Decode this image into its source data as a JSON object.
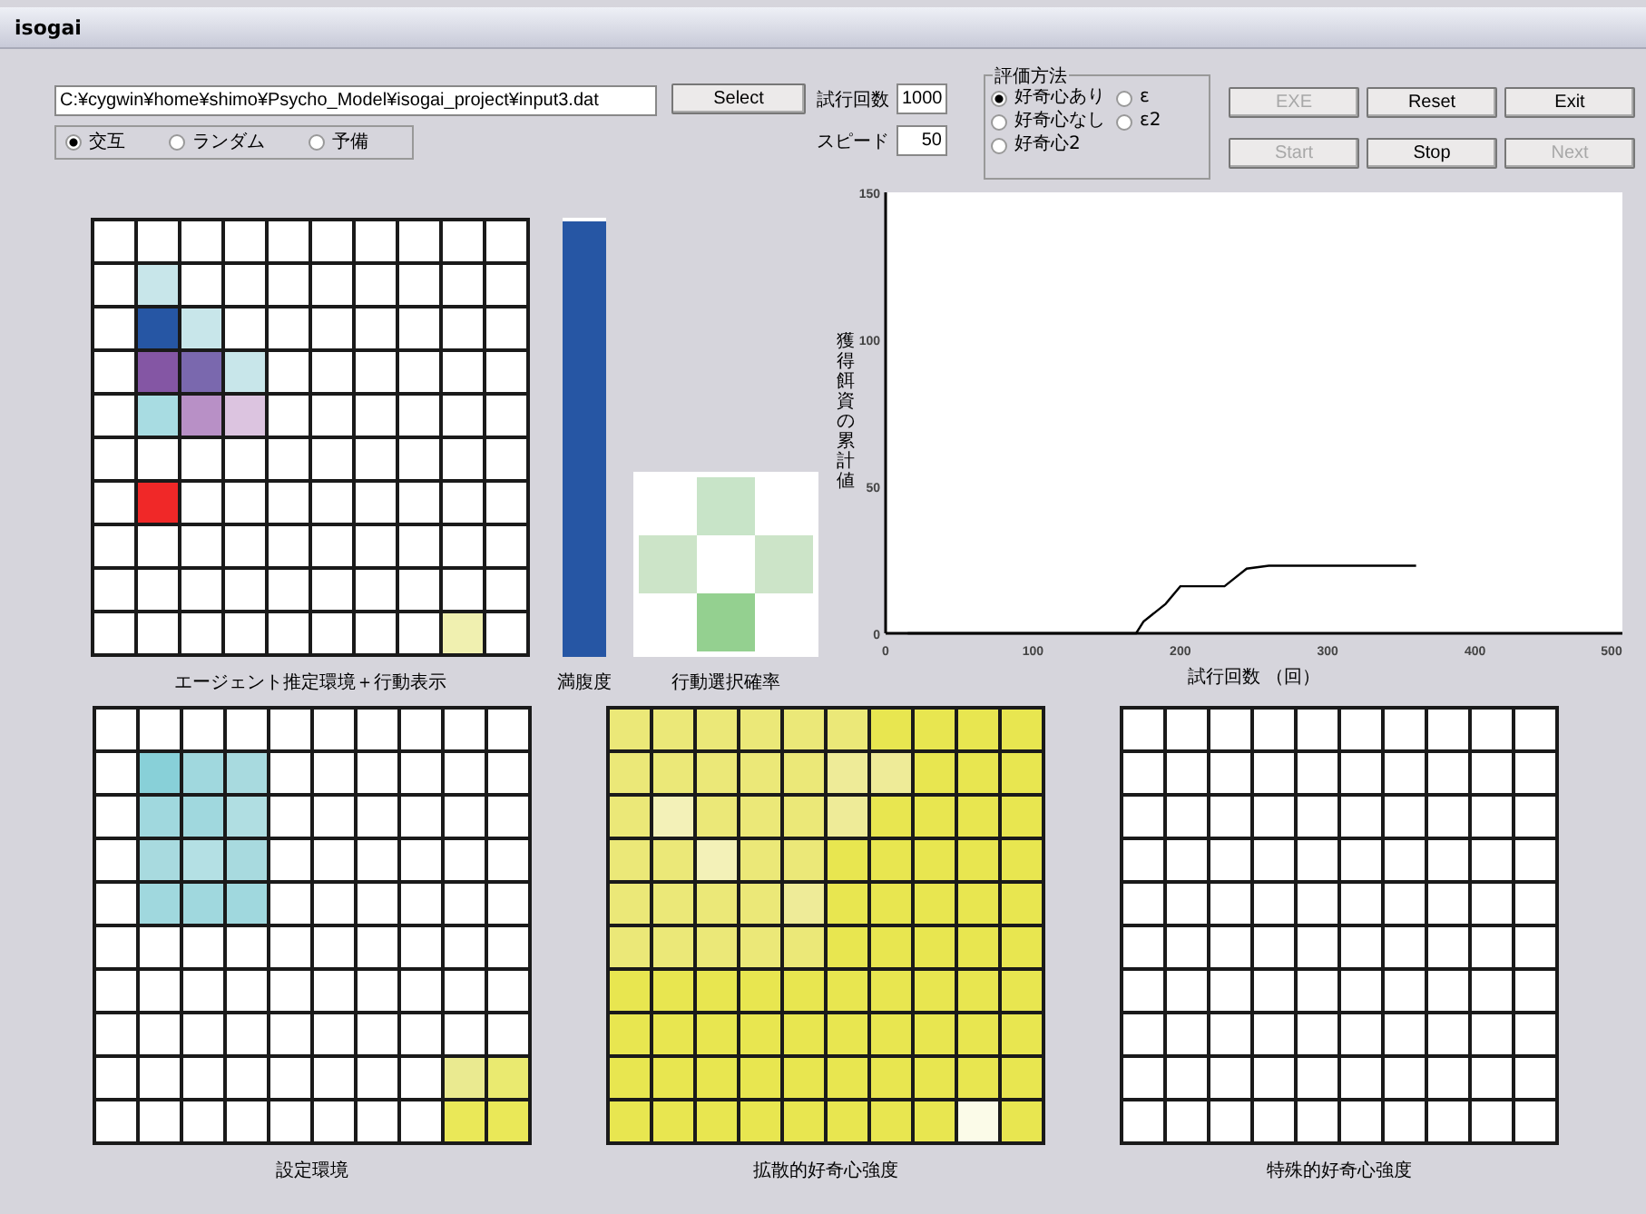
{
  "window": {
    "title": "isogai"
  },
  "file": {
    "path": "C:¥cygwin¥home¥shimo¥Psycho_Model¥isogai_project¥input3.dat",
    "button": "Select"
  },
  "order_options": [
    {
      "label": "交互",
      "selected": true
    },
    {
      "label": "ランダム",
      "selected": false
    },
    {
      "label": "予備",
      "selected": false
    }
  ],
  "settings": [
    {
      "label": "試行回数",
      "value": "1000"
    },
    {
      "label": "スピード",
      "value": "50"
    }
  ],
  "evaluation": {
    "title": "評価方法",
    "options": [
      {
        "label": "好奇心あり",
        "selected": true
      },
      {
        "label": "好奇心なし",
        "selected": false
      },
      {
        "label": "好奇心2",
        "selected": false
      },
      {
        "label": "ε",
        "selected": false
      },
      {
        "label": "ε2",
        "selected": false
      }
    ]
  },
  "buttons": [
    {
      "label": "EXE",
      "disabled": true
    },
    {
      "label": "Reset",
      "disabled": false
    },
    {
      "label": "Exit",
      "disabled": false
    },
    {
      "label": "Start",
      "disabled": true
    },
    {
      "label": "Stop",
      "disabled": false
    },
    {
      "label": "Next",
      "disabled": true
    }
  ],
  "agent_grid": {
    "caption": "エージェント推定環境＋行動表示",
    "rows": [
      [
        {
          "color": "#ffffff"
        },
        {
          "color": "#ffffff"
        },
        {
          "color": "#ffffff"
        },
        {
          "color": "#ffffff"
        },
        {
          "color": "#ffffff"
        },
        {
          "color": "#ffffff"
        },
        {
          "color": "#ffffff"
        },
        {
          "color": "#ffffff"
        },
        {
          "color": "#ffffff"
        },
        {
          "color": "#ffffff"
        }
      ],
      [
        {
          "color": "#ffffff"
        },
        {
          "color": "#c8e6ea"
        },
        {
          "color": "#ffffff"
        },
        {
          "color": "#ffffff"
        },
        {
          "color": "#ffffff"
        },
        {
          "color": "#ffffff"
        },
        {
          "color": "#ffffff"
        },
        {
          "color": "#ffffff"
        },
        {
          "color": "#ffffff"
        },
        {
          "color": "#ffffff"
        }
      ],
      [
        {
          "color": "#ffffff"
        },
        {
          "color": "#2656a4"
        },
        {
          "color": "#c8e6ea"
        },
        {
          "color": "#ffffff"
        },
        {
          "color": "#ffffff"
        },
        {
          "color": "#ffffff"
        },
        {
          "color": "#ffffff"
        },
        {
          "color": "#ffffff"
        },
        {
          "color": "#ffffff"
        },
        {
          "color": "#ffffff"
        }
      ],
      [
        {
          "color": "#ffffff"
        },
        {
          "color": "#8456a4"
        },
        {
          "color": "#7a68ae"
        },
        {
          "color": "#c8e6ea"
        },
        {
          "color": "#ffffff"
        },
        {
          "color": "#ffffff"
        },
        {
          "color": "#ffffff"
        },
        {
          "color": "#ffffff"
        },
        {
          "color": "#ffffff"
        },
        {
          "color": "#ffffff"
        }
      ],
      [
        {
          "color": "#ffffff"
        },
        {
          "color": "#a8dce2"
        },
        {
          "color": "#b890c6"
        },
        {
          "color": "#dcc4e0"
        },
        {
          "color": "#ffffff"
        },
        {
          "color": "#ffffff"
        },
        {
          "color": "#ffffff"
        },
        {
          "color": "#ffffff"
        },
        {
          "color": "#ffffff"
        },
        {
          "color": "#ffffff"
        }
      ],
      [
        {
          "color": "#ffffff"
        },
        {
          "color": "#ffffff"
        },
        {
          "color": "#ffffff"
        },
        {
          "color": "#ffffff"
        },
        {
          "color": "#ffffff"
        },
        {
          "color": "#ffffff"
        },
        {
          "color": "#ffffff"
        },
        {
          "color": "#ffffff"
        },
        {
          "color": "#ffffff"
        },
        {
          "color": "#ffffff"
        }
      ],
      [
        {
          "color": "#ffffff"
        },
        {
          "color": "#f02828"
        },
        {
          "color": "#ffffff"
        },
        {
          "color": "#ffffff"
        },
        {
          "color": "#ffffff"
        },
        {
          "color": "#ffffff"
        },
        {
          "color": "#ffffff"
        },
        {
          "color": "#ffffff"
        },
        {
          "color": "#ffffff"
        },
        {
          "color": "#ffffff"
        }
      ],
      [
        {
          "color": "#ffffff"
        },
        {
          "color": "#ffffff"
        },
        {
          "color": "#ffffff"
        },
        {
          "color": "#ffffff"
        },
        {
          "color": "#ffffff"
        },
        {
          "color": "#ffffff"
        },
        {
          "color": "#ffffff"
        },
        {
          "color": "#ffffff"
        },
        {
          "color": "#ffffff"
        },
        {
          "color": "#ffffff"
        }
      ],
      [
        {
          "color": "#ffffff"
        },
        {
          "color": "#ffffff"
        },
        {
          "color": "#ffffff"
        },
        {
          "color": "#ffffff"
        },
        {
          "color": "#ffffff"
        },
        {
          "color": "#ffffff"
        },
        {
          "color": "#ffffff"
        },
        {
          "color": "#ffffff"
        },
        {
          "color": "#ffffff"
        },
        {
          "color": "#ffffff"
        }
      ],
      [
        {
          "color": "#ffffff"
        },
        {
          "color": "#ffffff"
        },
        {
          "color": "#ffffff"
        },
        {
          "color": "#ffffff"
        },
        {
          "color": "#ffffff"
        },
        {
          "color": "#ffffff"
        },
        {
          "color": "#ffffff"
        },
        {
          "color": "#ffffff"
        },
        {
          "color": "#f0f0b0"
        },
        {
          "color": "#ffffff"
        }
      ]
    ]
  },
  "satiety": {
    "caption": "満腹度",
    "level": 0.99
  },
  "action_probability": {
    "caption": "行動選択確率",
    "cells": [
      {
        "kind": "up",
        "color": "#c8e4c8"
      },
      {
        "kind": "left",
        "color": "#cce4c8"
      },
      {
        "kind": "right",
        "color": "#cce4c8"
      },
      {
        "kind": "down",
        "color": "#94d090"
      }
    ]
  },
  "chart": {
    "chart_data": {
      "type": "line",
      "xlabel": "試行回数 （回）",
      "ylabel": "獲得餌資の累計値",
      "x": [
        15,
        170,
        175,
        185,
        190,
        200,
        230,
        235,
        245,
        260,
        360
      ],
      "series": [
        {
          "color": "#000000",
          "values": [
            0,
            0,
            4,
            8,
            10,
            16,
            16,
            18,
            22,
            23,
            23
          ]
        }
      ],
      "xlim": [
        0,
        500
      ],
      "ylim": [
        0,
        150
      ],
      "xticks": [
        0,
        100,
        200,
        300,
        400,
        500
      ],
      "yticks": [
        0,
        50,
        100,
        150
      ]
    }
  },
  "setting_grid": {
    "caption": "設定環境",
    "rows": [
      [
        {
          "color": "#ffffff"
        },
        {
          "color": "#ffffff"
        },
        {
          "color": "#ffffff"
        },
        {
          "color": "#ffffff"
        },
        {
          "color": "#ffffff"
        },
        {
          "color": "#ffffff"
        },
        {
          "color": "#ffffff"
        },
        {
          "color": "#ffffff"
        },
        {
          "color": "#ffffff"
        },
        {
          "color": "#ffffff"
        }
      ],
      [
        {
          "color": "#ffffff"
        },
        {
          "color": "#88d0d8"
        },
        {
          "color": "#a0d8de"
        },
        {
          "color": "#a8dadf"
        },
        {
          "color": "#ffffff"
        },
        {
          "color": "#ffffff"
        },
        {
          "color": "#ffffff"
        },
        {
          "color": "#ffffff"
        },
        {
          "color": "#ffffff"
        },
        {
          "color": "#ffffff"
        }
      ],
      [
        {
          "color": "#ffffff"
        },
        {
          "color": "#a0d8de"
        },
        {
          "color": "#a0d8de"
        },
        {
          "color": "#b0dee2"
        },
        {
          "color": "#ffffff"
        },
        {
          "color": "#ffffff"
        },
        {
          "color": "#ffffff"
        },
        {
          "color": "#ffffff"
        },
        {
          "color": "#ffffff"
        },
        {
          "color": "#ffffff"
        }
      ],
      [
        {
          "color": "#ffffff"
        },
        {
          "color": "#a8dadf"
        },
        {
          "color": "#b4e0e4"
        },
        {
          "color": "#a8dadf"
        },
        {
          "color": "#ffffff"
        },
        {
          "color": "#ffffff"
        },
        {
          "color": "#ffffff"
        },
        {
          "color": "#ffffff"
        },
        {
          "color": "#ffffff"
        },
        {
          "color": "#ffffff"
        }
      ],
      [
        {
          "color": "#ffffff"
        },
        {
          "color": "#a0d8de"
        },
        {
          "color": "#a0d8de"
        },
        {
          "color": "#a0d8de"
        },
        {
          "color": "#ffffff"
        },
        {
          "color": "#ffffff"
        },
        {
          "color": "#ffffff"
        },
        {
          "color": "#ffffff"
        },
        {
          "color": "#ffffff"
        },
        {
          "color": "#ffffff"
        }
      ],
      [
        {
          "color": "#ffffff"
        },
        {
          "color": "#ffffff"
        },
        {
          "color": "#ffffff"
        },
        {
          "color": "#ffffff"
        },
        {
          "color": "#ffffff"
        },
        {
          "color": "#ffffff"
        },
        {
          "color": "#ffffff"
        },
        {
          "color": "#ffffff"
        },
        {
          "color": "#ffffff"
        },
        {
          "color": "#ffffff"
        }
      ],
      [
        {
          "color": "#ffffff"
        },
        {
          "color": "#ffffff"
        },
        {
          "color": "#ffffff"
        },
        {
          "color": "#ffffff"
        },
        {
          "color": "#ffffff"
        },
        {
          "color": "#ffffff"
        },
        {
          "color": "#ffffff"
        },
        {
          "color": "#ffffff"
        },
        {
          "color": "#ffffff"
        },
        {
          "color": "#ffffff"
        }
      ],
      [
        {
          "color": "#ffffff"
        },
        {
          "color": "#ffffff"
        },
        {
          "color": "#ffffff"
        },
        {
          "color": "#ffffff"
        },
        {
          "color": "#ffffff"
        },
        {
          "color": "#ffffff"
        },
        {
          "color": "#ffffff"
        },
        {
          "color": "#ffffff"
        },
        {
          "color": "#ffffff"
        },
        {
          "color": "#ffffff"
        }
      ],
      [
        {
          "color": "#ffffff"
        },
        {
          "color": "#ffffff"
        },
        {
          "color": "#ffffff"
        },
        {
          "color": "#ffffff"
        },
        {
          "color": "#ffffff"
        },
        {
          "color": "#ffffff"
        },
        {
          "color": "#ffffff"
        },
        {
          "color": "#ffffff"
        },
        {
          "color": "#eaea90"
        },
        {
          "color": "#eaea70"
        }
      ],
      [
        {
          "color": "#ffffff"
        },
        {
          "color": "#ffffff"
        },
        {
          "color": "#ffffff"
        },
        {
          "color": "#ffffff"
        },
        {
          "color": "#ffffff"
        },
        {
          "color": "#ffffff"
        },
        {
          "color": "#ffffff"
        },
        {
          "color": "#ffffff"
        },
        {
          "color": "#eae858"
        },
        {
          "color": "#eae858"
        }
      ]
    ]
  },
  "diffusive_grid": {
    "caption": "拡散的好奇心強度",
    "rows": [
      [
        {
          "color": "#ebe878"
        },
        {
          "color": "#ebe878"
        },
        {
          "color": "#ebe878"
        },
        {
          "color": "#ebe878"
        },
        {
          "color": "#ebe878"
        },
        {
          "color": "#ebe878"
        },
        {
          "color": "#e8e650"
        },
        {
          "color": "#e8e650"
        },
        {
          "color": "#e8e650"
        },
        {
          "color": "#e8e650"
        }
      ],
      [
        {
          "color": "#ebe878"
        },
        {
          "color": "#ebe878"
        },
        {
          "color": "#ebe878"
        },
        {
          "color": "#ebe878"
        },
        {
          "color": "#ebe878"
        },
        {
          "color": "#eeeb98"
        },
        {
          "color": "#eeeb98"
        },
        {
          "color": "#e8e650"
        },
        {
          "color": "#e8e650"
        },
        {
          "color": "#e8e650"
        }
      ],
      [
        {
          "color": "#ebe878"
        },
        {
          "color": "#f3f1b8"
        },
        {
          "color": "#ebe878"
        },
        {
          "color": "#ebe878"
        },
        {
          "color": "#ebe878"
        },
        {
          "color": "#eeeb98"
        },
        {
          "color": "#e8e650"
        },
        {
          "color": "#e8e650"
        },
        {
          "color": "#e8e650"
        },
        {
          "color": "#e8e650"
        }
      ],
      [
        {
          "color": "#ebe878"
        },
        {
          "color": "#ebe878"
        },
        {
          "color": "#f3f1b8"
        },
        {
          "color": "#ebe878"
        },
        {
          "color": "#ebe878"
        },
        {
          "color": "#e8e650"
        },
        {
          "color": "#e8e650"
        },
        {
          "color": "#e8e650"
        },
        {
          "color": "#e8e650"
        },
        {
          "color": "#e8e650"
        }
      ],
      [
        {
          "color": "#ebe878"
        },
        {
          "color": "#ebe878"
        },
        {
          "color": "#ebe878"
        },
        {
          "color": "#ebe878"
        },
        {
          "color": "#eeeb98"
        },
        {
          "color": "#e8e650"
        },
        {
          "color": "#e8e650"
        },
        {
          "color": "#e8e650"
        },
        {
          "color": "#e8e650"
        },
        {
          "color": "#e8e650"
        }
      ],
      [
        {
          "color": "#ebe878"
        },
        {
          "color": "#ebe878"
        },
        {
          "color": "#ebe878"
        },
        {
          "color": "#ebe878"
        },
        {
          "color": "#ebe878"
        },
        {
          "color": "#e8e650"
        },
        {
          "color": "#e8e650"
        },
        {
          "color": "#e8e650"
        },
        {
          "color": "#e8e650"
        },
        {
          "color": "#e8e650"
        }
      ],
      [
        {
          "color": "#e8e650"
        },
        {
          "color": "#e8e650"
        },
        {
          "color": "#e8e650"
        },
        {
          "color": "#e8e650"
        },
        {
          "color": "#e8e650"
        },
        {
          "color": "#e8e650"
        },
        {
          "color": "#e8e650"
        },
        {
          "color": "#e8e650"
        },
        {
          "color": "#e8e650"
        },
        {
          "color": "#e8e650"
        }
      ],
      [
        {
          "color": "#e8e650"
        },
        {
          "color": "#e8e650"
        },
        {
          "color": "#e8e650"
        },
        {
          "color": "#e8e650"
        },
        {
          "color": "#e8e650"
        },
        {
          "color": "#e8e650"
        },
        {
          "color": "#e8e650"
        },
        {
          "color": "#e8e650"
        },
        {
          "color": "#e8e650"
        },
        {
          "color": "#e8e650"
        }
      ],
      [
        {
          "color": "#e8e650"
        },
        {
          "color": "#e8e650"
        },
        {
          "color": "#e8e650"
        },
        {
          "color": "#e8e650"
        },
        {
          "color": "#e8e650"
        },
        {
          "color": "#e8e650"
        },
        {
          "color": "#e8e650"
        },
        {
          "color": "#e8e650"
        },
        {
          "color": "#e8e650"
        },
        {
          "color": "#e8e650"
        }
      ],
      [
        {
          "color": "#e8e650"
        },
        {
          "color": "#e8e650"
        },
        {
          "color": "#e8e650"
        },
        {
          "color": "#e8e650"
        },
        {
          "color": "#e8e650"
        },
        {
          "color": "#e8e650"
        },
        {
          "color": "#e8e650"
        },
        {
          "color": "#e8e650"
        },
        {
          "color": "#fbfbe8"
        },
        {
          "color": "#e8e650"
        }
      ]
    ]
  },
  "specific_grid": {
    "caption": "特殊的好奇心強度",
    "rows": [
      [
        {
          "color": "#ffffff"
        },
        {
          "color": "#ffffff"
        },
        {
          "color": "#ffffff"
        },
        {
          "color": "#ffffff"
        },
        {
          "color": "#ffffff"
        },
        {
          "color": "#ffffff"
        },
        {
          "color": "#ffffff"
        },
        {
          "color": "#ffffff"
        },
        {
          "color": "#ffffff"
        },
        {
          "color": "#ffffff"
        }
      ],
      [
        {
          "color": "#ffffff"
        },
        {
          "color": "#ffffff"
        },
        {
          "color": "#ffffff"
        },
        {
          "color": "#ffffff"
        },
        {
          "color": "#ffffff"
        },
        {
          "color": "#ffffff"
        },
        {
          "color": "#ffffff"
        },
        {
          "color": "#ffffff"
        },
        {
          "color": "#ffffff"
        },
        {
          "color": "#ffffff"
        }
      ],
      [
        {
          "color": "#ffffff"
        },
        {
          "color": "#ffffff"
        },
        {
          "color": "#ffffff"
        },
        {
          "color": "#ffffff"
        },
        {
          "color": "#ffffff"
        },
        {
          "color": "#ffffff"
        },
        {
          "color": "#ffffff"
        },
        {
          "color": "#ffffff"
        },
        {
          "color": "#ffffff"
        },
        {
          "color": "#ffffff"
        }
      ],
      [
        {
          "color": "#ffffff"
        },
        {
          "color": "#ffffff"
        },
        {
          "color": "#ffffff"
        },
        {
          "color": "#ffffff"
        },
        {
          "color": "#ffffff"
        },
        {
          "color": "#ffffff"
        },
        {
          "color": "#ffffff"
        },
        {
          "color": "#ffffff"
        },
        {
          "color": "#ffffff"
        },
        {
          "color": "#ffffff"
        }
      ],
      [
        {
          "color": "#ffffff"
        },
        {
          "color": "#ffffff"
        },
        {
          "color": "#ffffff"
        },
        {
          "color": "#ffffff"
        },
        {
          "color": "#ffffff"
        },
        {
          "color": "#ffffff"
        },
        {
          "color": "#ffffff"
        },
        {
          "color": "#ffffff"
        },
        {
          "color": "#ffffff"
        },
        {
          "color": "#ffffff"
        }
      ],
      [
        {
          "color": "#ffffff"
        },
        {
          "color": "#ffffff"
        },
        {
          "color": "#ffffff"
        },
        {
          "color": "#ffffff"
        },
        {
          "color": "#ffffff"
        },
        {
          "color": "#ffffff"
        },
        {
          "color": "#ffffff"
        },
        {
          "color": "#ffffff"
        },
        {
          "color": "#ffffff"
        },
        {
          "color": "#ffffff"
        }
      ],
      [
        {
          "color": "#ffffff"
        },
        {
          "color": "#ffffff"
        },
        {
          "color": "#ffffff"
        },
        {
          "color": "#ffffff"
        },
        {
          "color": "#ffffff"
        },
        {
          "color": "#ffffff"
        },
        {
          "color": "#ffffff"
        },
        {
          "color": "#ffffff"
        },
        {
          "color": "#ffffff"
        },
        {
          "color": "#ffffff"
        }
      ],
      [
        {
          "color": "#ffffff"
        },
        {
          "color": "#ffffff"
        },
        {
          "color": "#ffffff"
        },
        {
          "color": "#ffffff"
        },
        {
          "color": "#ffffff"
        },
        {
          "color": "#ffffff"
        },
        {
          "color": "#ffffff"
        },
        {
          "color": "#ffffff"
        },
        {
          "color": "#ffffff"
        },
        {
          "color": "#ffffff"
        }
      ],
      [
        {
          "color": "#ffffff"
        },
        {
          "color": "#ffffff"
        },
        {
          "color": "#ffffff"
        },
        {
          "color": "#ffffff"
        },
        {
          "color": "#ffffff"
        },
        {
          "color": "#ffffff"
        },
        {
          "color": "#ffffff"
        },
        {
          "color": "#ffffff"
        },
        {
          "color": "#ffffff"
        },
        {
          "color": "#ffffff"
        }
      ],
      [
        {
          "color": "#ffffff"
        },
        {
          "color": "#ffffff"
        },
        {
          "color": "#ffffff"
        },
        {
          "color": "#ffffff"
        },
        {
          "color": "#ffffff"
        },
        {
          "color": "#ffffff"
        },
        {
          "color": "#ffffff"
        },
        {
          "color": "#ffffff"
        },
        {
          "color": "#ffffff"
        },
        {
          "color": "#ffffff"
        }
      ]
    ]
  }
}
